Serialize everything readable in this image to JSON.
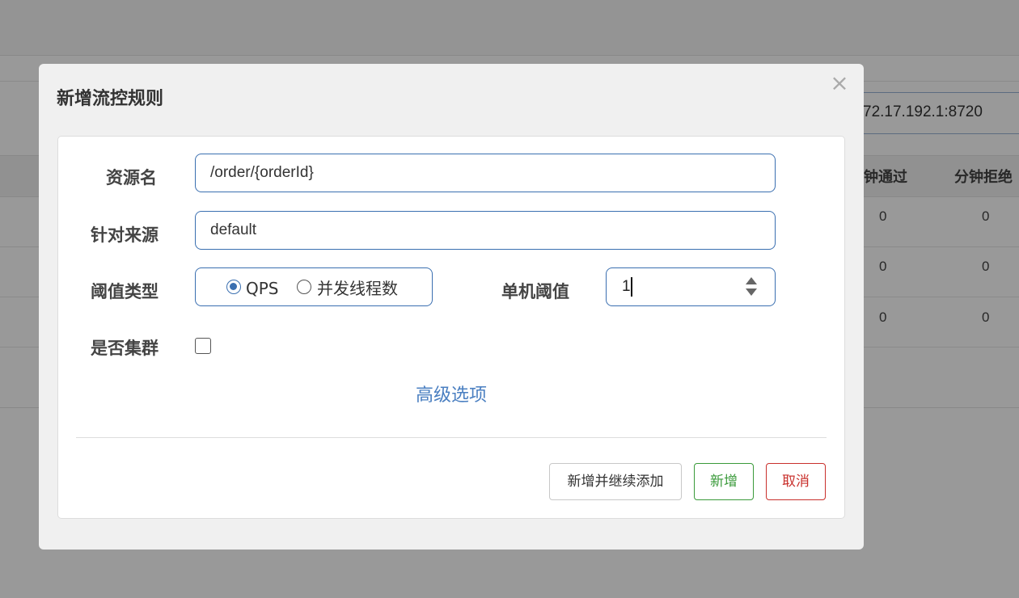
{
  "background": {
    "machine_text": "72.17.192.1:8720",
    "headers": [
      "分钟通过",
      "分钟拒绝"
    ],
    "rows": [
      [
        "0",
        "0"
      ],
      [
        "0",
        "0"
      ],
      [
        "0",
        "0"
      ]
    ]
  },
  "dialog": {
    "title": "新增流控规则",
    "close_icon": "×",
    "fields": {
      "resource": {
        "label": "资源名",
        "value": "/order/{orderId}"
      },
      "origin": {
        "label": "针对来源",
        "value": "default"
      },
      "threshold_type": {
        "label": "阈值类型",
        "options": [
          "QPS",
          "并发线程数"
        ],
        "selected": "QPS"
      },
      "threshold": {
        "label": "单机阈值",
        "value": "1"
      },
      "cluster": {
        "label": "是否集群",
        "checked": false
      }
    },
    "advanced_link": "高级选项",
    "buttons": {
      "continue": "新增并继续添加",
      "add": "新增",
      "cancel": "取消"
    }
  },
  "colors": {
    "accent": "#3a6fb0",
    "link": "#4a7fc1",
    "success": "#3a9a3a",
    "danger": "#c9302c",
    "overlay": "rgba(0,0,0,0.40)"
  }
}
